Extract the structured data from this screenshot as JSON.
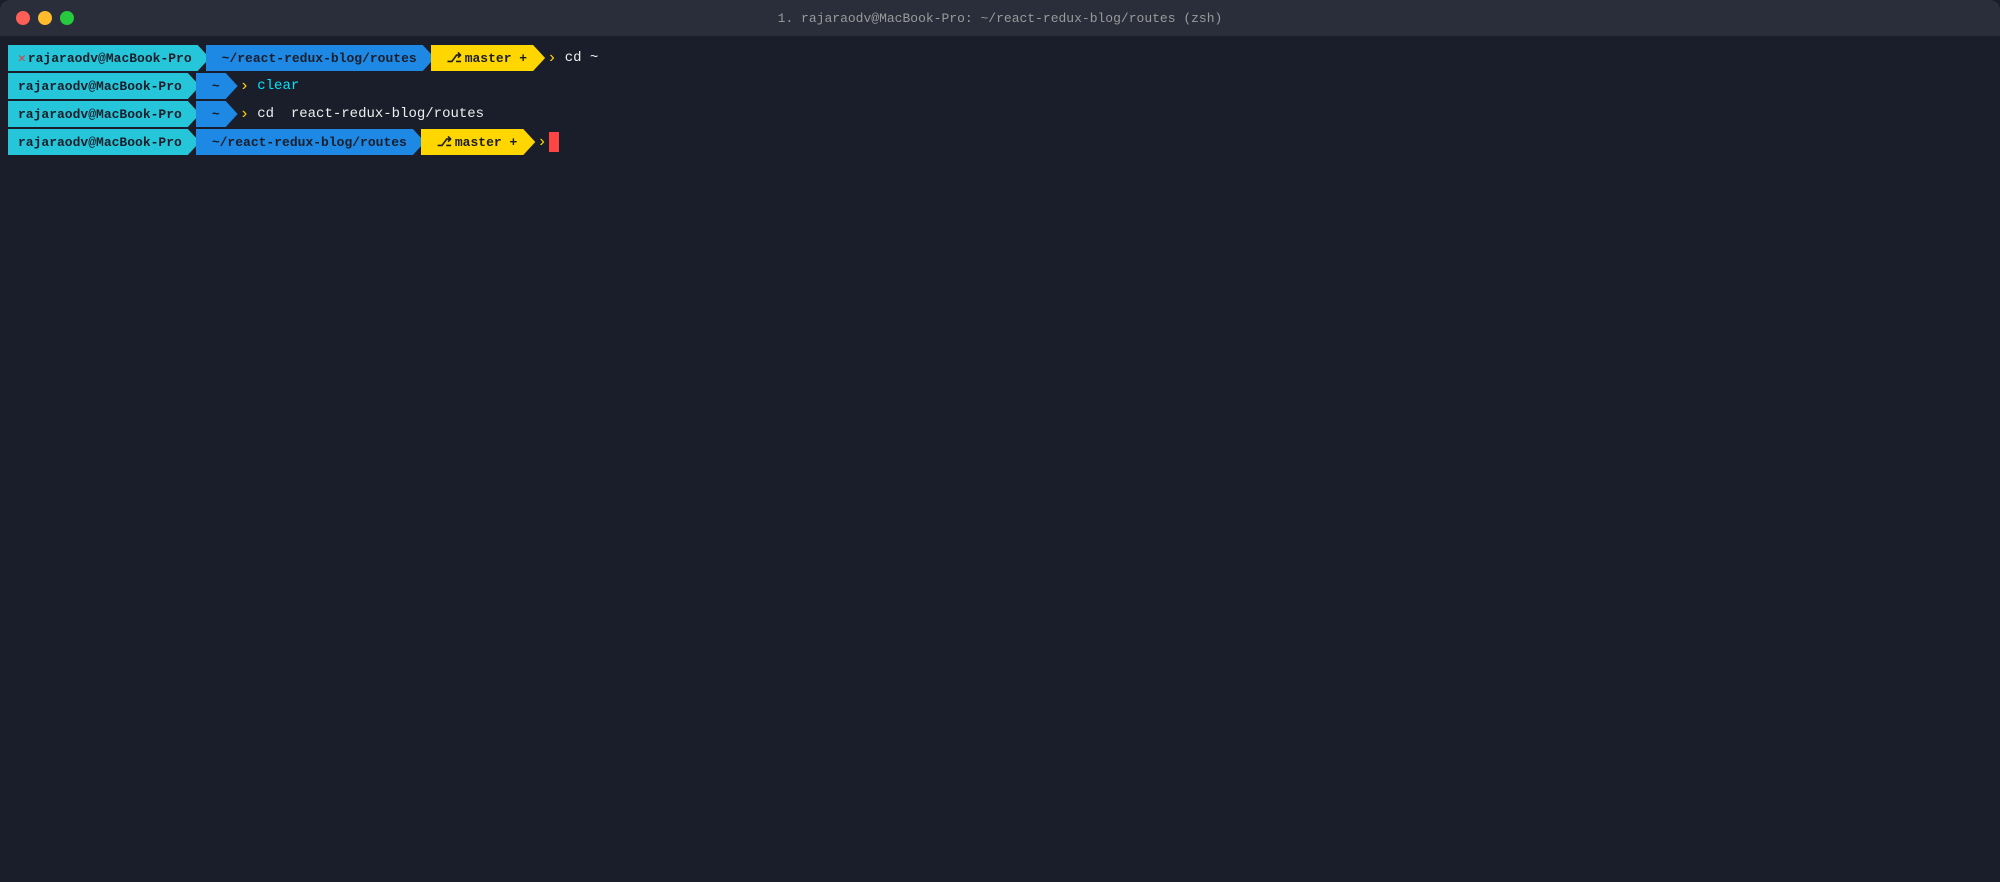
{
  "window": {
    "title": "1. rajaraodv@MacBook-Pro: ~/react-redux-blog/routes (zsh)"
  },
  "controls": {
    "close": "×",
    "minimize": "–",
    "maximize": "+"
  },
  "lines": [
    {
      "type": "command",
      "user": "rajaraodv@MacBook-Pro",
      "path": "~/react-redux-blog/routes",
      "git": " master +",
      "cmd": "cd ~",
      "has_error": true
    },
    {
      "type": "command",
      "user": "rajaraodv@MacBook-Pro",
      "path": "~",
      "git": null,
      "cmd": "clear",
      "cmd_color": "cyan",
      "has_error": false
    },
    {
      "type": "command",
      "user": "rajaraodv@MacBook-Pro",
      "path": "~",
      "git": null,
      "cmd": "cd  react-redux-blog/routes",
      "cmd_color": "white",
      "has_error": false
    },
    {
      "type": "prompt",
      "user": "rajaraodv@MacBook-Pro",
      "path": "~/react-redux-blog/routes",
      "git": " master +",
      "cursor": true,
      "has_error": false
    }
  ]
}
